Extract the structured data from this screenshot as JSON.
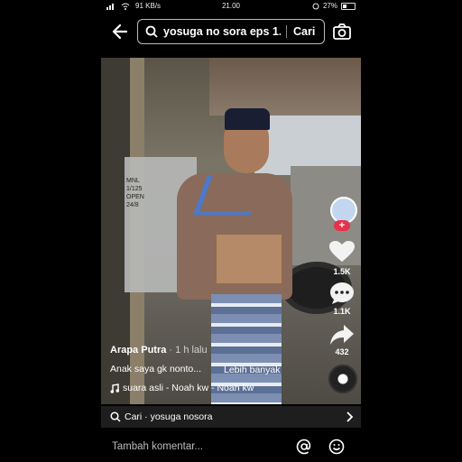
{
  "status": {
    "speed": "91 KB/s",
    "time": "21.00",
    "battery": "27%"
  },
  "search": {
    "query": "yosuga no sora eps 1...",
    "button": "Cari"
  },
  "video": {
    "sign_text": "MNL\n1/125\nOPEN\n24/8"
  },
  "actions": {
    "likes": "1.5K",
    "comments": "1.1K",
    "shares": "432"
  },
  "caption": {
    "author": "Arapa Putra",
    "time_ago": "· 1 h lalu",
    "description": "Anak saya gk nonto...",
    "more": "Lebih banyak",
    "music": "suara asli - Noah kw - Noah kw"
  },
  "related": {
    "text": "Cari · yosuga nosora"
  },
  "comment": {
    "placeholder": "Tambah komentar..."
  },
  "colors": {
    "accent_red": "#e6324b",
    "background": "#000000"
  }
}
